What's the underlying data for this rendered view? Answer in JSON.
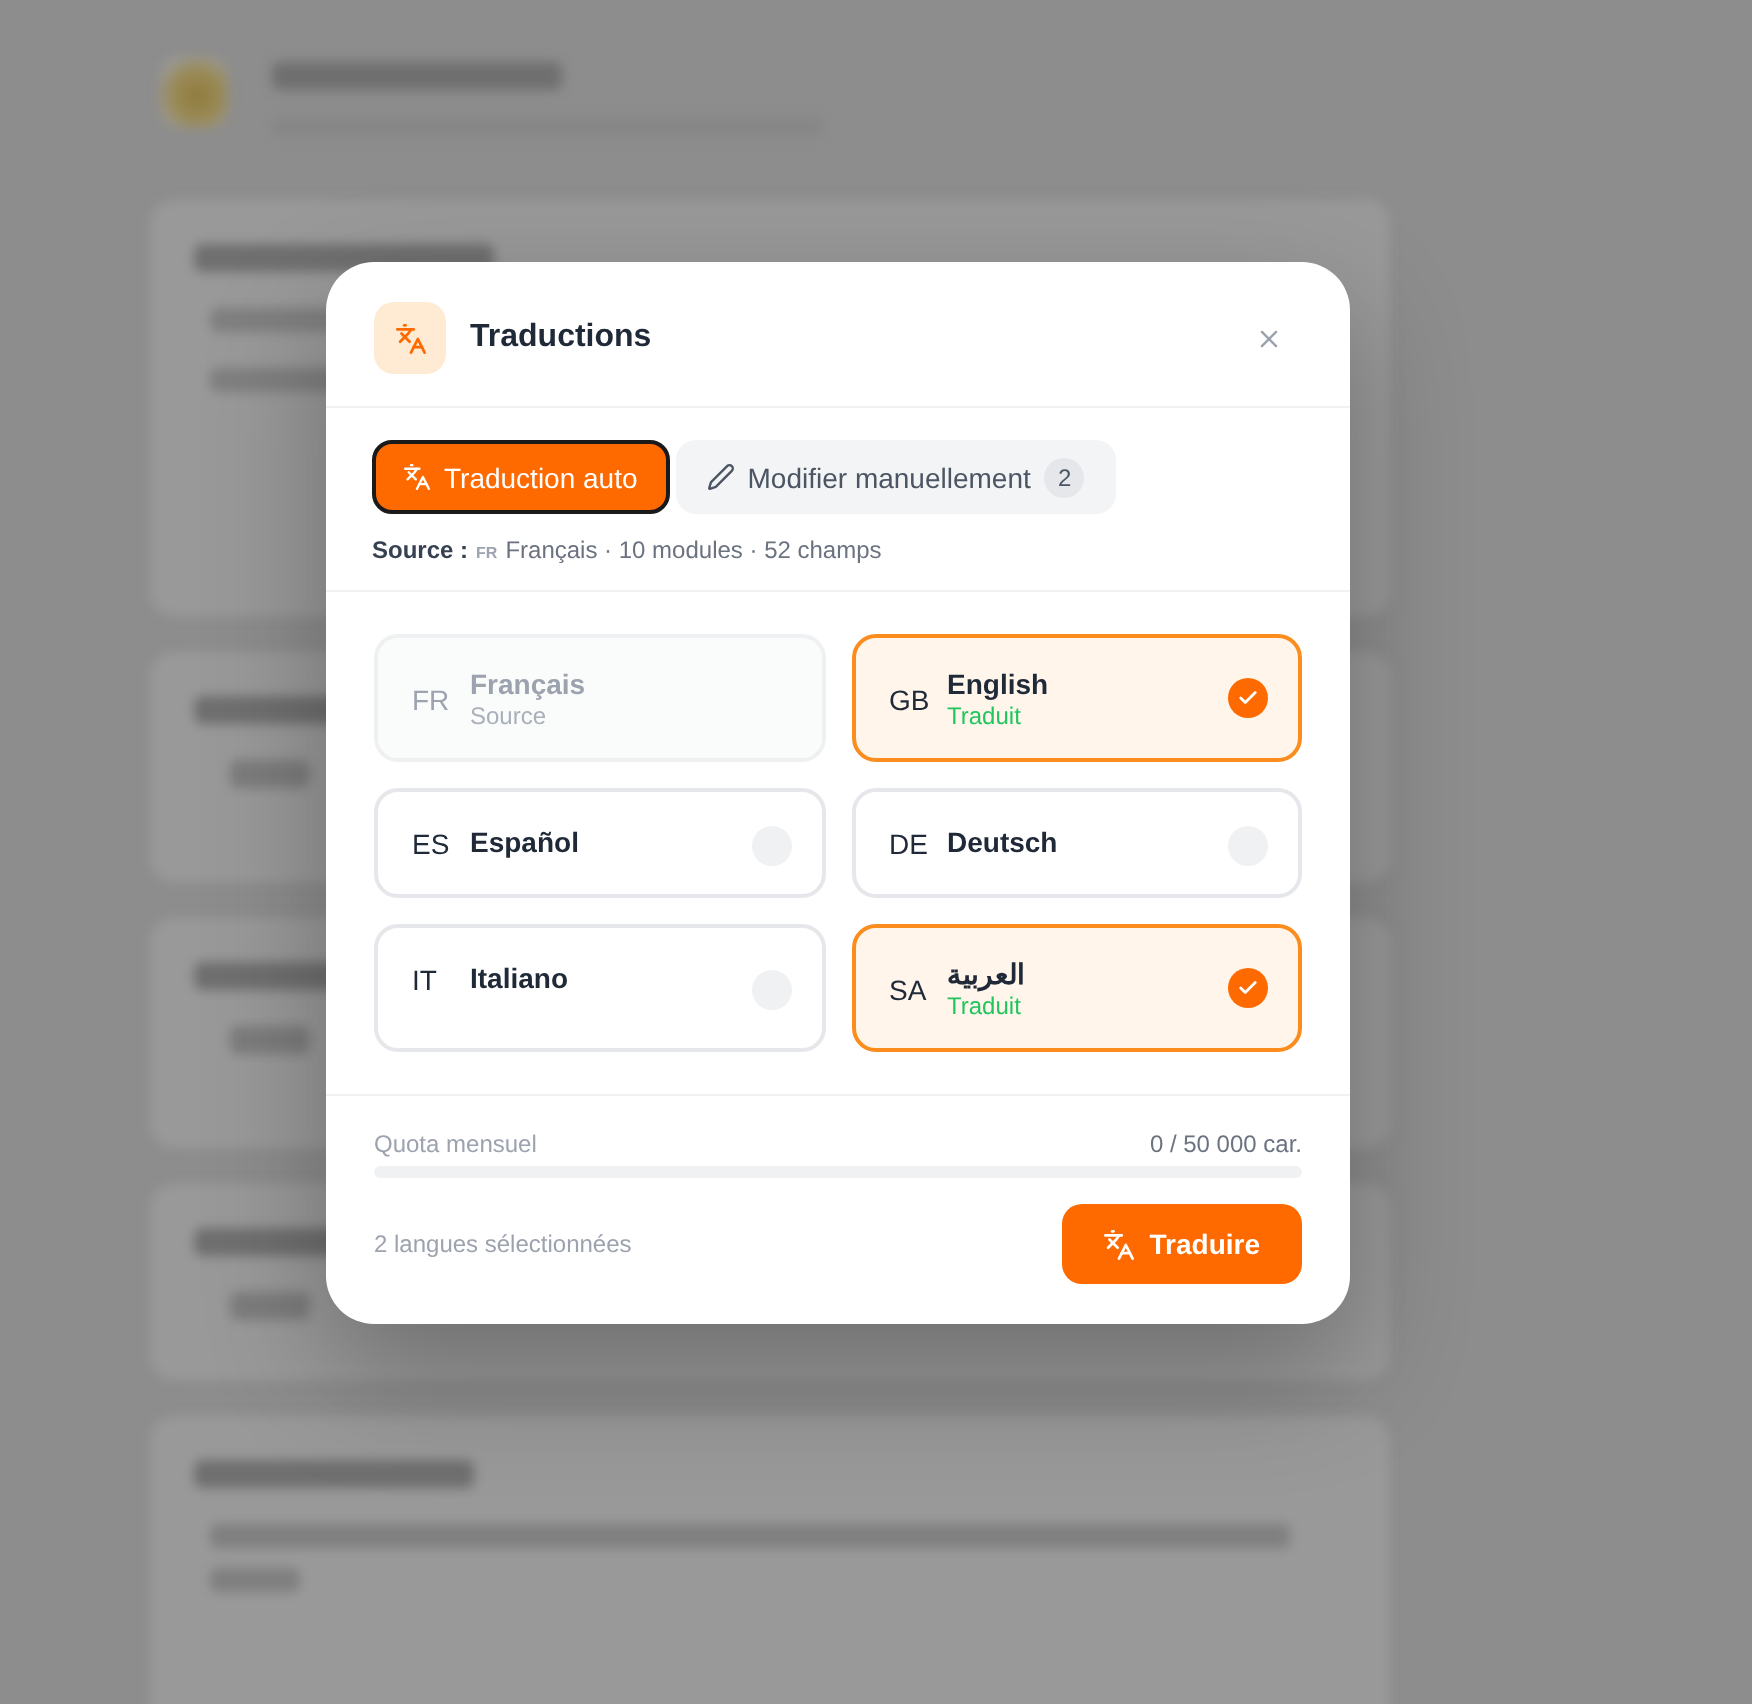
{
  "dialog": {
    "title": "Traductions"
  },
  "tabs": [
    {
      "kind": "auto",
      "label": "Traduction auto",
      "selected": true,
      "focused": true
    },
    {
      "kind": "manual",
      "label": "Modifier manuellement",
      "badge": "2",
      "selected": false,
      "focused": false
    }
  ],
  "source": {
    "label": "Source :",
    "code": "FR",
    "details": "Français · 10 modules · 52 champs"
  },
  "languages": [
    {
      "code": "FR",
      "name": "Français",
      "status": "Source",
      "selected": false,
      "disabled": true
    },
    {
      "code": "GB",
      "name": "English",
      "status": "Traduit",
      "selected": true,
      "disabled": false
    },
    {
      "code": "ES",
      "name": "Español",
      "selected": false,
      "disabled": false
    },
    {
      "code": "DE",
      "name": "Deutsch",
      "selected": false,
      "disabled": false
    },
    {
      "code": "IT",
      "name": "Italiano",
      "selected": false,
      "disabled": false
    },
    {
      "code": "SA",
      "name": "العربية",
      "status": "Traduit",
      "selected": true,
      "disabled": false
    }
  ],
  "quota": {
    "label": "Quota mensuel",
    "reading": "0 / 50 000 car.",
    "level": 0
  },
  "footer": {
    "selection": "2 langues sélectionnées",
    "button": "Traduire"
  }
}
